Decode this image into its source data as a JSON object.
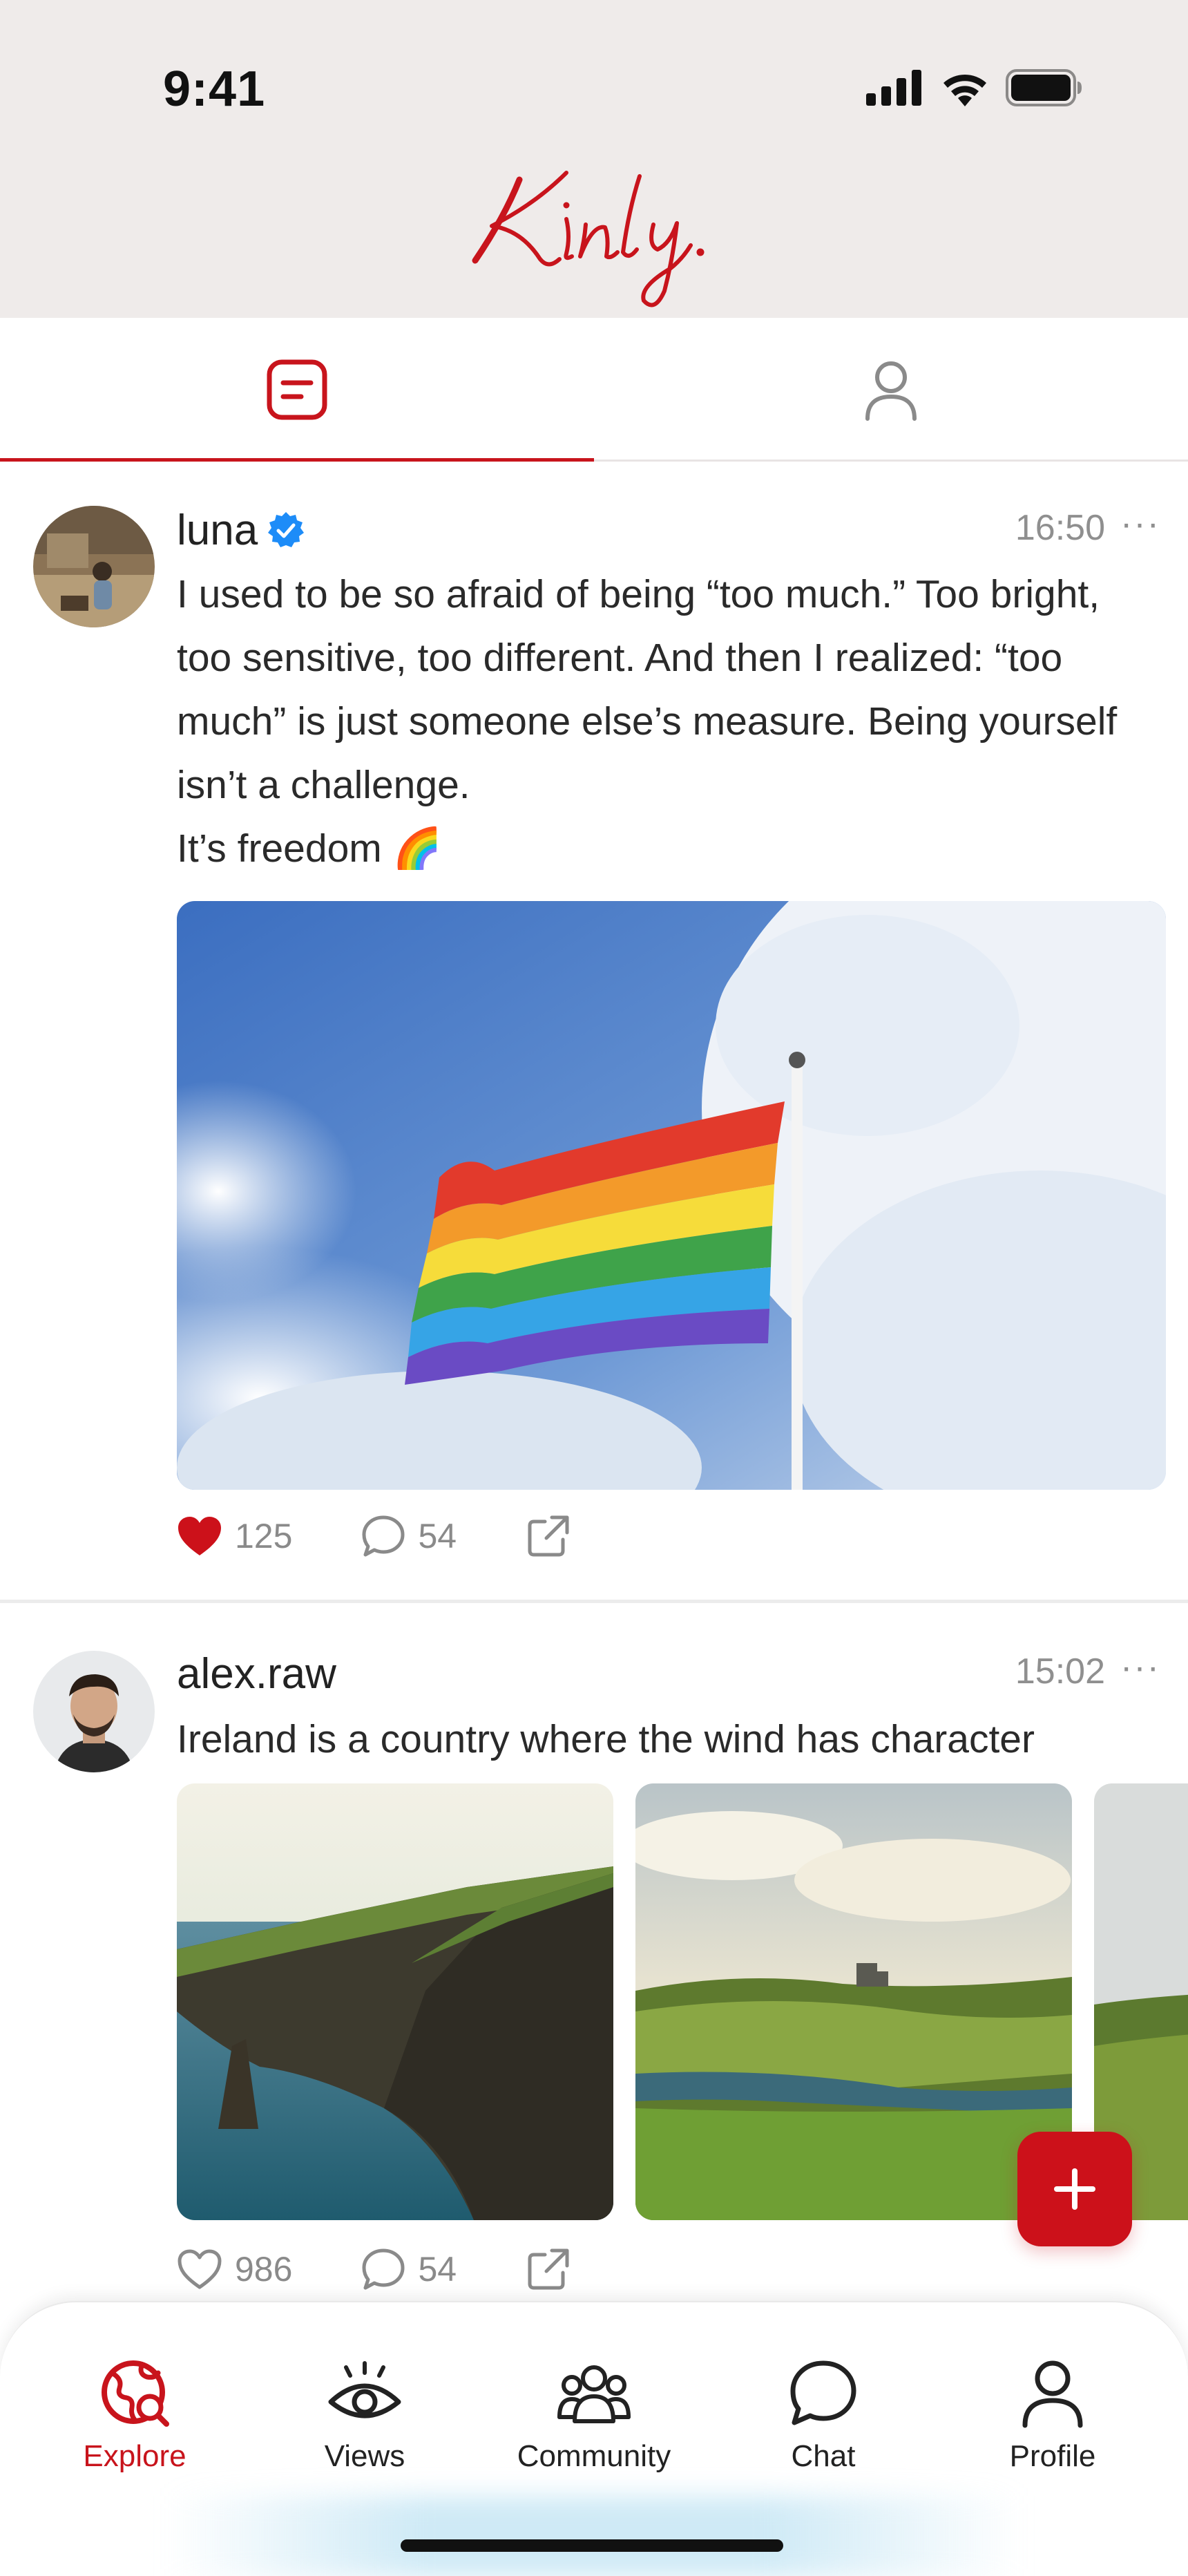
{
  "status_bar": {
    "time": "9:41"
  },
  "header": {
    "logo_text": "Kinly."
  },
  "tabs": [
    {
      "name": "posts",
      "active": true
    },
    {
      "name": "people",
      "active": false
    }
  ],
  "posts": [
    {
      "username": "luna",
      "verified": true,
      "time": "16:50",
      "text_lines": [
        "I used to be so afraid of being “too much.” Too bright, too sensitive, too different. And then I realized: “too much” is just someone else’s measure. Being yourself isn’t a challenge.",
        "It’s freedom 🌈"
      ],
      "likes": "125",
      "liked": true,
      "comments": "54"
    },
    {
      "username": "alex.raw",
      "verified": false,
      "time": "15:02",
      "text": "Ireland is a country where the wind has character",
      "likes": "986",
      "liked": false,
      "comments": "54"
    }
  ],
  "bottom_nav": [
    {
      "label": "Explore",
      "icon": "explore-globe-icon",
      "active": true
    },
    {
      "label": "Views",
      "icon": "eye-icon",
      "active": false
    },
    {
      "label": "Community",
      "icon": "community-icon",
      "active": false
    },
    {
      "label": "Chat",
      "icon": "chat-bubble-icon",
      "active": false
    },
    {
      "label": "Profile",
      "icon": "person-icon",
      "active": false
    }
  ],
  "colors": {
    "accent": "#c8141c",
    "header_bg": "#efebea",
    "verified": "#1d8cf8"
  }
}
